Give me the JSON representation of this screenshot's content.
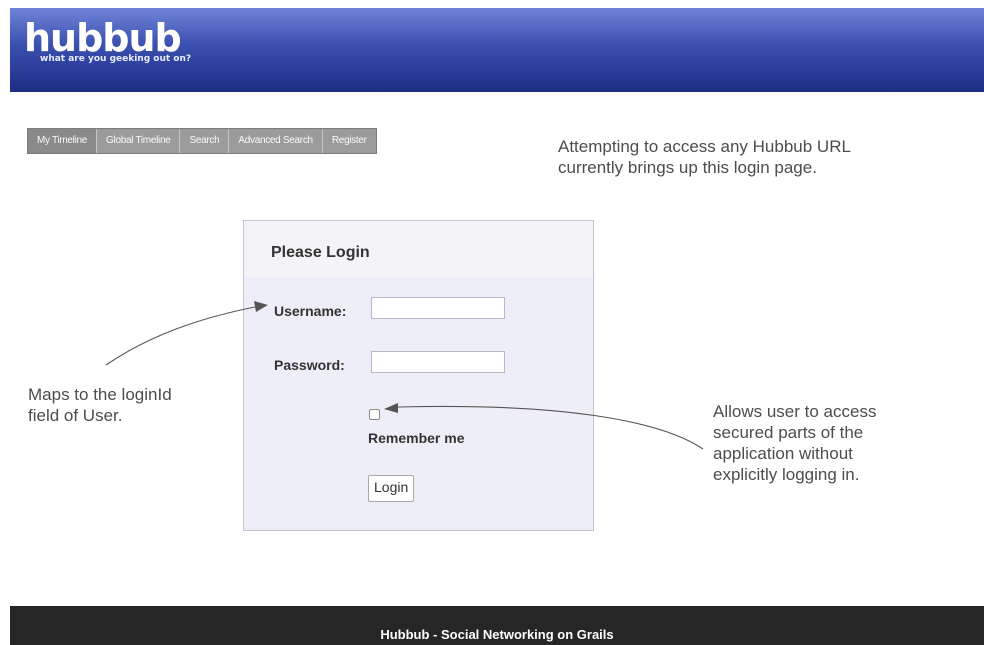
{
  "header": {
    "logo_text": "hubbub",
    "tagline": "what are you geeking out on?"
  },
  "nav": {
    "items": [
      {
        "label": "My Timeline"
      },
      {
        "label": "Global Timeline"
      },
      {
        "label": "Search"
      },
      {
        "label": "Advanced Search"
      },
      {
        "label": "Register"
      }
    ]
  },
  "annotations": {
    "top_note_line1": "Attempting to access any Hubbub URL",
    "top_note_line2": "currently brings up this login page.",
    "left_note_line1": "Maps to the loginId",
    "left_note_line2": "field of User.",
    "right_note_line1": "Allows user to access",
    "right_note_line2": "secured parts of the",
    "right_note_line3": "application without",
    "right_note_line4": "explicitly logging in."
  },
  "login": {
    "title": "Please Login",
    "username_label": "Username:",
    "username_value": "",
    "password_label": "Password:",
    "password_value": "",
    "remember_label": "Remember me",
    "remember_checked": false,
    "button_label": "Login"
  },
  "footer": {
    "text": "Hubbub - Social Networking on Grails"
  }
}
